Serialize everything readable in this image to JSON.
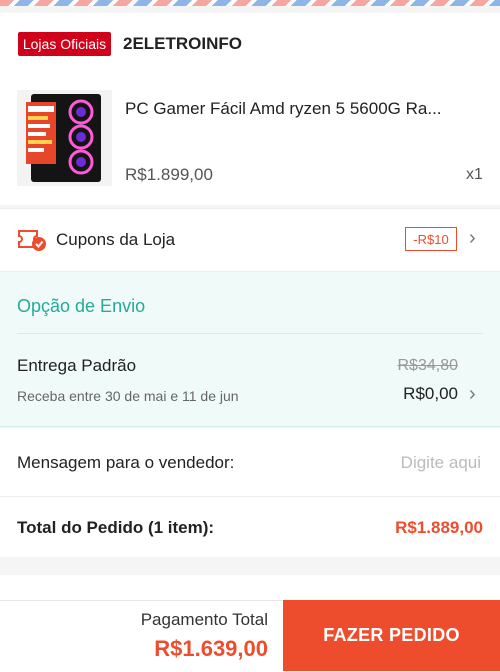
{
  "shop": {
    "badge": "Lojas Oficiais",
    "name": "2ELETROINFO"
  },
  "product": {
    "title": "PC Gamer Fácil Amd ryzen 5 5600G Ra...",
    "price": "R$1.899,00",
    "quantity": "x1",
    "image_alt": "PC gamer case with RGB fans"
  },
  "coupon": {
    "label": "Cupons da Loja",
    "tag": "-R$10"
  },
  "shipping": {
    "section_title": "Opção de Envio",
    "method": "Entrega Padrão",
    "delivery_window": "Receba entre 30 de mai e 11 de jun",
    "original_price": "R$34,80",
    "price": "R$0,00"
  },
  "message": {
    "label": "Mensagem para o vendedor:",
    "placeholder": "Digite aqui"
  },
  "order_total": {
    "label": "Total do Pedido (1 item):",
    "value": "R$1.889,00"
  },
  "footer": {
    "payment_label": "Pagamento Total",
    "payment_value": "R$1.639,00",
    "place_order_label": "FAZER PEDIDO"
  },
  "colors": {
    "accent": "#ee4d2d",
    "official_red": "#d0011b",
    "shipping_teal": "#26aa99",
    "shipping_bg": "#effaf9"
  }
}
